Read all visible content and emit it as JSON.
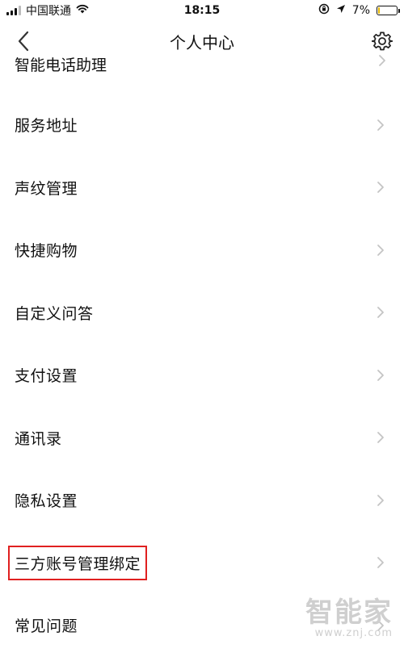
{
  "status_bar": {
    "carrier": "中国联通",
    "time": "18:15",
    "battery_percent_label": "7%",
    "battery_level": 0.07
  },
  "nav": {
    "title": "个人中心",
    "back_icon": "chevron-left-icon",
    "settings_icon": "gear-icon"
  },
  "partial_item": {
    "label": "智能电话助理"
  },
  "menu": {
    "items": [
      {
        "label": "服务地址"
      },
      {
        "label": "声纹管理"
      },
      {
        "label": "快捷购物"
      },
      {
        "label": "自定义问答"
      },
      {
        "label": "支付设置"
      },
      {
        "label": "通讯录"
      },
      {
        "label": "隐私设置"
      },
      {
        "label": "三方账号管理绑定",
        "highlighted": true
      },
      {
        "label": "常见问题"
      }
    ]
  },
  "watermark": {
    "brand": "智能家",
    "url": "www.znj.com"
  },
  "colors": {
    "highlight_border": "#e02020",
    "chevron": "#c4c4c4",
    "text": "#111111"
  }
}
